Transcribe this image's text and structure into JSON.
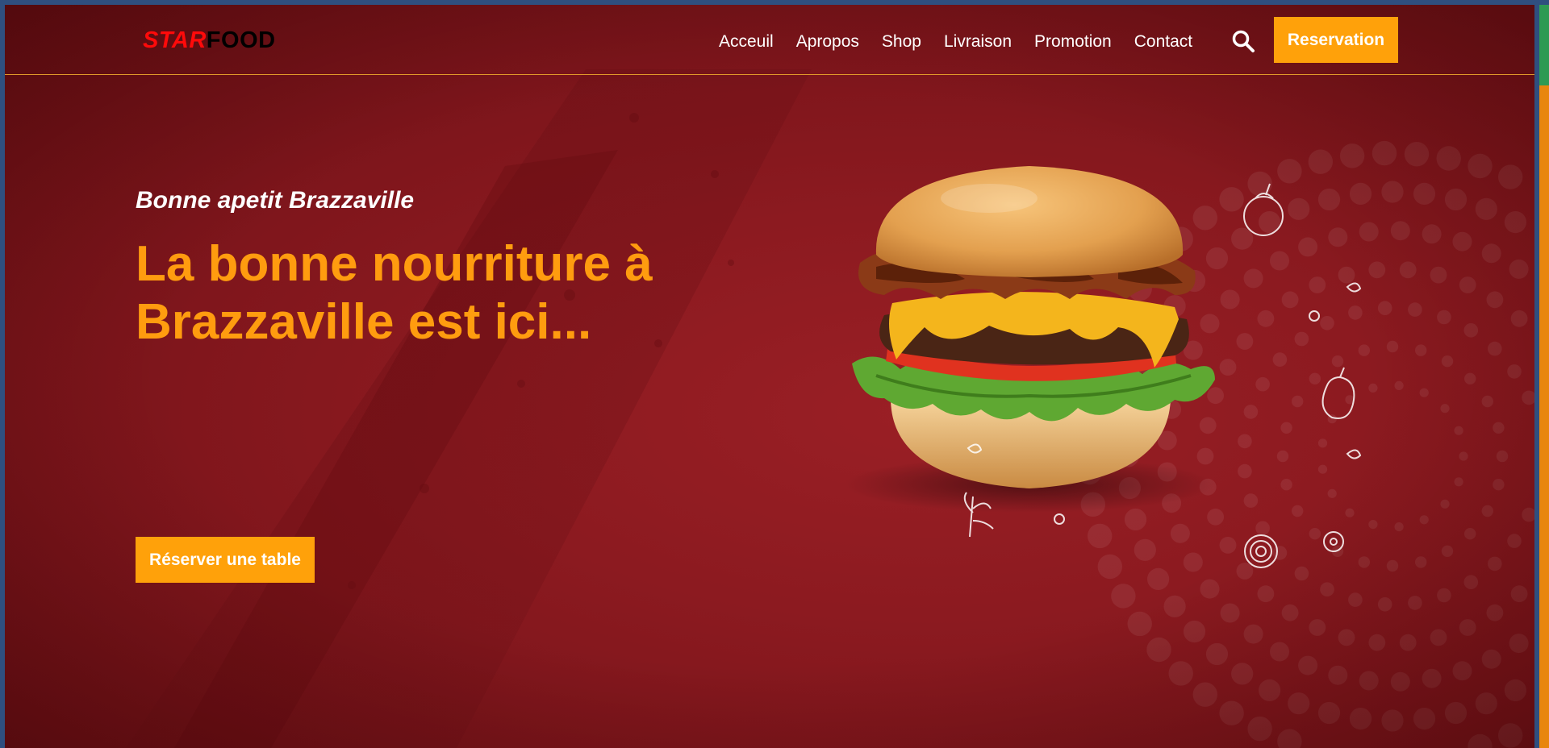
{
  "header": {
    "logo": {
      "part1": "STAR",
      "part2": "FOOD"
    },
    "nav": [
      {
        "label": "Acceuil"
      },
      {
        "label": "Apropos"
      },
      {
        "label": "Shop"
      },
      {
        "label": "Livraison"
      },
      {
        "label": "Promotion"
      },
      {
        "label": "Contact"
      }
    ],
    "search_icon": "search-icon",
    "reservation_label": "Reservation"
  },
  "hero": {
    "subtitle": "Bonne apetit Brazzaville",
    "headline": "La bonne nourriture à Brazzaville est ici...",
    "cta_label": "Réserver une table",
    "image": "burger-image"
  },
  "colors": {
    "background": "#8c1a20",
    "accent": "#ffa10a",
    "headline": "#ff9c0f",
    "logo_star": "#ff0a0a",
    "logo_food": "#000000"
  }
}
